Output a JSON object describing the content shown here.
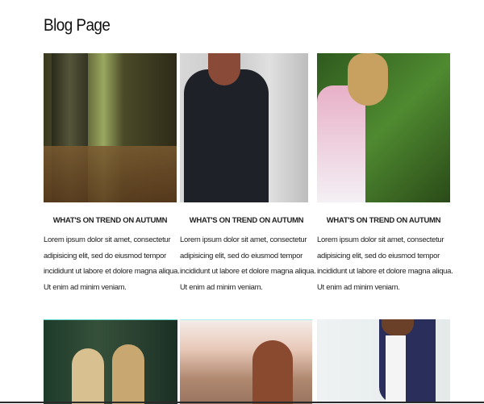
{
  "page": {
    "title": "Blog Page"
  },
  "posts": [
    {
      "heading": "WHAT'S ON TREND ON AUTUMN",
      "text": "Lorem ipsum dolor sit amet, consectetur adipisicing elit, sed do eiusmod tempor incididunt ut labore et dolore magna aliqua. Ut enim ad minim veniam.",
      "image": "forest-tree-photo"
    },
    {
      "heading": "WHAT'S ON TREND ON AUTUMN",
      "text": "Lorem ipsum dolor sit amet, consectetur adipisicing elit, sed do eiusmod tempor incididunt ut labore et dolore magna aliqua. Ut enim ad minim veniam.",
      "image": "woman-winter-coat-photo"
    },
    {
      "heading": "WHAT'S ON TREND ON AUTUMN",
      "text": "Lorem ipsum dolor sit amet, consectetur adipisicing elit, sed do eiusmod tempor incididunt ut labore et dolore magna aliqua. Ut enim ad minim veniam.",
      "image": "girl-in-grass-photo"
    }
  ],
  "second_row_images": [
    "sparklers-photo",
    "woman-sunlight-photo",
    "man-in-suit-photo"
  ]
}
